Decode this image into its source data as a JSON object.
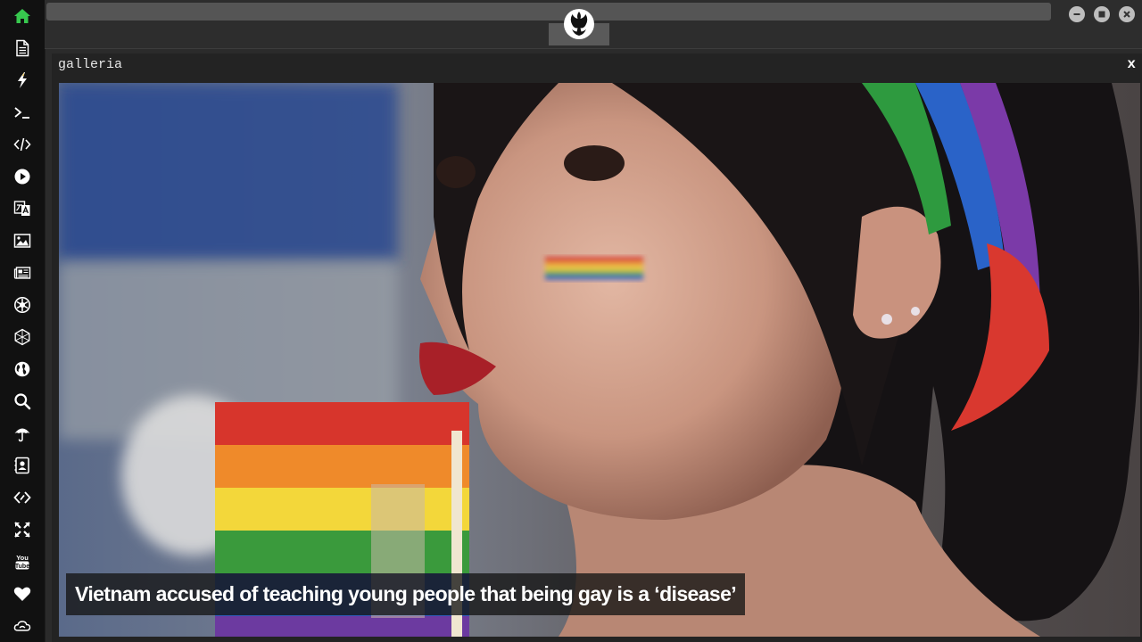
{
  "sidebar": {
    "items": [
      {
        "icon": "home-icon"
      },
      {
        "icon": "document-icon"
      },
      {
        "icon": "lightning-icon"
      },
      {
        "icon": "terminal-icon"
      },
      {
        "icon": "code-icon"
      },
      {
        "icon": "play-icon"
      },
      {
        "icon": "translate-icon"
      },
      {
        "icon": "image-icon"
      },
      {
        "icon": "newspaper-icon"
      },
      {
        "icon": "rebel-icon"
      },
      {
        "icon": "hexagon-icon"
      },
      {
        "icon": "globe-icon"
      },
      {
        "icon": "search-icon"
      },
      {
        "icon": "umbrella-icon"
      },
      {
        "icon": "contact-icon"
      },
      {
        "icon": "link-code-icon"
      },
      {
        "icon": "expand-icon"
      },
      {
        "icon": "youtube-icon"
      },
      {
        "icon": "heart-icon"
      },
      {
        "icon": "cloud-icon"
      }
    ],
    "active_color": "#37c84e",
    "icon_color": "#ffffff"
  },
  "topbar": {
    "logo_icon": "rebel-alliance-icon",
    "window_buttons": [
      "minimize-icon",
      "maximize-icon",
      "close-icon"
    ]
  },
  "gallery": {
    "title": "galleria",
    "close_label": "x",
    "caption": "Vietnam accused of teaching young people that being gay is a ‘disease’"
  }
}
